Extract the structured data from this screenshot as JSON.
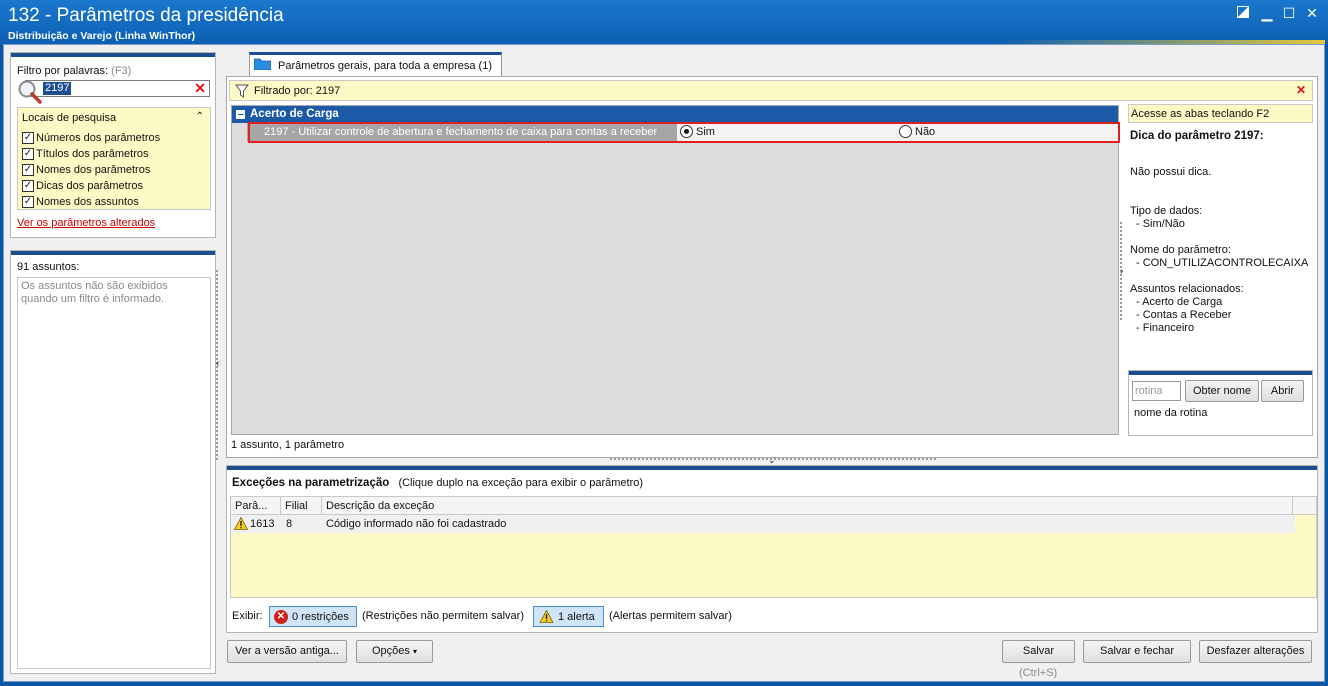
{
  "window": {
    "title": "132 - Parâmetros da presidência",
    "subtitle": "Distribuição e Varejo (Linha WinThor)"
  },
  "filter": {
    "label": "Filtro por palavras:",
    "shortcut": "(F3)",
    "value": "2197",
    "locais_title": "Locais de pesquisa",
    "options": [
      {
        "label": "Números dos parâmetros",
        "checked": true
      },
      {
        "label": "Títulos dos parâmetros",
        "checked": true
      },
      {
        "label": "Nomes dos parâmetros",
        "checked": true
      },
      {
        "label": "Dicas dos parâmetros",
        "checked": true
      },
      {
        "label": "Nomes dos assuntos",
        "checked": true
      }
    ],
    "ver_alterados": "Ver os parâmetros alterados"
  },
  "assuntos": {
    "count_label": "91 assuntos:",
    "message": "Os assuntos não são exibidos quando um filtro é informado."
  },
  "tab": {
    "label": "Parâmetros gerais, para toda a empresa  (1)"
  },
  "filter_bar": {
    "label": "Filtrado por: 2197"
  },
  "grid": {
    "group": "Acerto de Carga",
    "param_label": "2197 - Utilizar controle de abertura e fechamento de caixa para contas a receber",
    "option_sim": "Sim",
    "option_nao": "Não",
    "selected": "Sim",
    "footer": "1 assunto, 1 parâmetro"
  },
  "dica": {
    "f2_hint": "Acesse as abas teclando F2",
    "title": "Dica do parâmetro 2197:",
    "text": "Não possui dica.",
    "tipo_label": "Tipo de dados:",
    "tipo_value": "- Sim/Não",
    "nome_label": "Nome do parâmetro:",
    "nome_value": "- CON_UTILIZACONTROLECAIXA",
    "assuntos_label": "Assuntos relacionados:",
    "assuntos": [
      "- Acerto de Carga",
      "- Contas a Receber",
      "- Financeiro"
    ]
  },
  "rotina": {
    "placeholder": "rotina",
    "obter_label": "Obter nome",
    "abrir_label": "Abrir",
    "caption": "nome da rotina"
  },
  "excecoes": {
    "title": "Exceções na parametrização",
    "hint": "(Clique duplo na exceção para exibir o parâmetro)",
    "columns": [
      "Parâ...",
      "Filial",
      "Descrição da exceção"
    ],
    "rows": [
      {
        "param": "1613",
        "filial": "8",
        "descricao": "Código informado não foi cadastrado"
      }
    ],
    "exibir_label": "Exibir:",
    "restricoes_label": "0 restrições",
    "restricoes_note": "(Restrições não permitem salvar)",
    "alertas_label": "1 alerta",
    "alertas_note": "(Alertas permitem salvar)"
  },
  "buttons": {
    "versao_antiga": "Ver a versão antiga...",
    "opcoes": "Opções",
    "salvar": "Salvar",
    "salvar_shortcut": "(Ctrl+S)",
    "salvar_fechar": "Salvar e fechar",
    "desfazer": "Desfazer alterações"
  },
  "colors": {
    "title_bar": "#0d5fb3",
    "group_header": "#1c5aa8",
    "highlight_border": "#e02020",
    "info_yellow": "#fdfac5"
  }
}
